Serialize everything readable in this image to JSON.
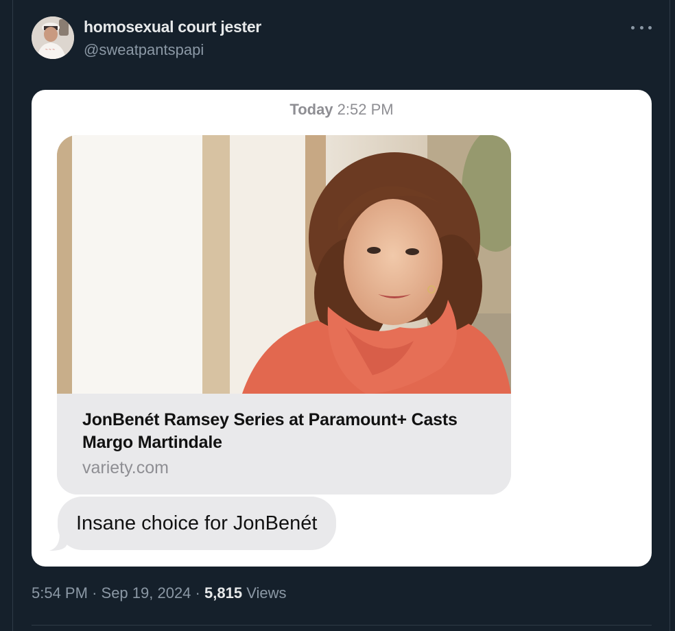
{
  "author": {
    "display_name": "homosexual court jester",
    "handle": "@sweatpantspapi",
    "avatar_icon": "profile-photo"
  },
  "menu_icon": "more-horizontal-icon",
  "message_screenshot": {
    "timestamp_day": "Today",
    "timestamp_time": "2:52 PM",
    "link_preview": {
      "title": "JonBenét Ramsey Series at Paramount+ Casts Margo Martindale",
      "domain": "variety.com"
    },
    "message_text": "Insane choice for JonBenét"
  },
  "meta": {
    "time": "5:54 PM",
    "date": "Sep 19, 2024",
    "separator": "·",
    "views_count": "5,815",
    "views_label": "Views"
  },
  "colors": {
    "background": "#15202b",
    "bubble_gray": "#e9e9eb",
    "text_primary": "#e7e9ea",
    "text_secondary": "#8b98a5"
  }
}
